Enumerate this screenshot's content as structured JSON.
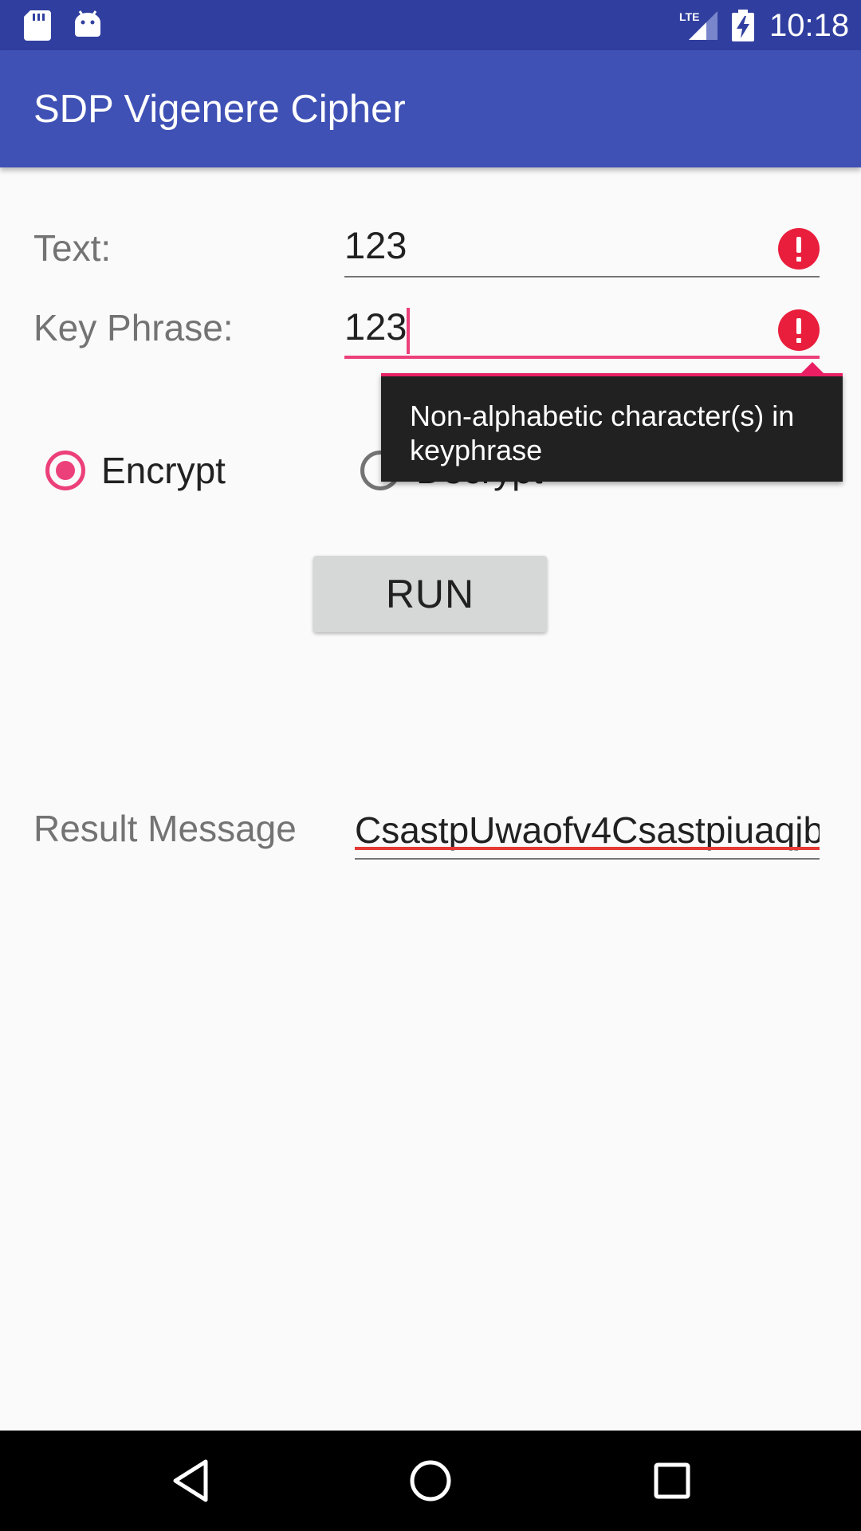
{
  "status_bar": {
    "time": "10:18",
    "icons": [
      "sd-card-icon",
      "android-icon",
      "lte-signal-icon",
      "battery-charging-icon"
    ],
    "lte_label": "LTE"
  },
  "app_bar": {
    "title": "SDP Vigenere Cipher",
    "color": "#3F51B5"
  },
  "form": {
    "text_label": "Text:",
    "text_value": "123",
    "keyphrase_label": "Key Phrase:",
    "keyphrase_value": "123",
    "error_message": "Non-alphabetic character(s) in keyphrase",
    "error_color": "#E91E63"
  },
  "mode": {
    "encrypt_label": "Encrypt",
    "decrypt_label": "Decrypt",
    "selected": "Encrypt",
    "accent": "#EC407A"
  },
  "run_button": {
    "label": "RUN"
  },
  "result": {
    "label": "Result Message",
    "value": "CsastpUwaofv4Csastpiuaqjb"
  },
  "nav_bar": {
    "buttons": [
      "back-icon",
      "home-icon",
      "recents-icon"
    ]
  }
}
